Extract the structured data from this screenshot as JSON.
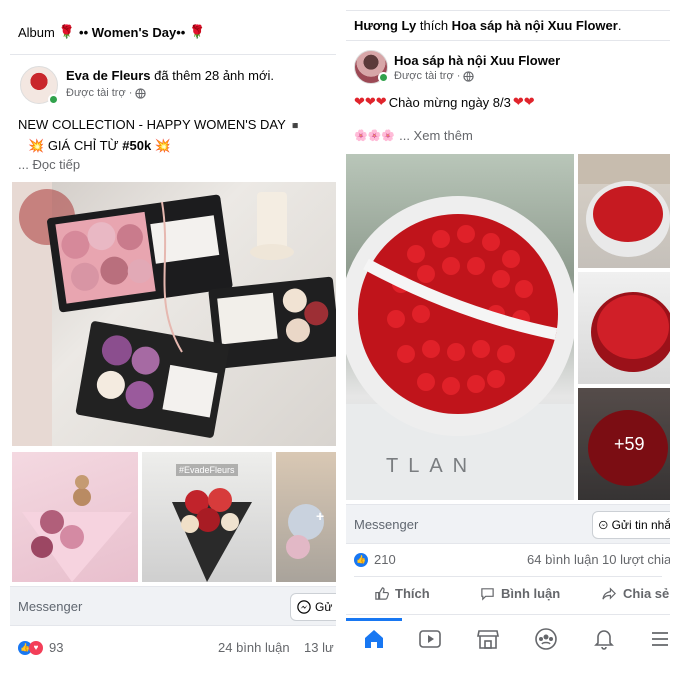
{
  "left": {
    "album_header": {
      "prefix": "Album",
      "emoji_left": "🌹",
      "title": "•• Women's Day••",
      "emoji_right": "🌹"
    },
    "page_name": "Eva de Fleurs",
    "action_text": "đã thêm 28 ảnh mới.",
    "sponsored": "Được tài trợ ·",
    "post_line1": "NEW COLLECTION - HAPPY WOMEN'S DAY",
    "post_line1_icon": "◾",
    "post_line2_prefix": "GIÁ CHỈ TỪ",
    "post_line2_price": "#50k",
    "post_line2_emoji": "💥",
    "read_more": "... Đọc tiếp",
    "thumb_label": "#EvadeFleurs",
    "messenger_label": "Messenger",
    "messenger_button": "Gử",
    "reactions_count": "93",
    "comments_count": "24 bình luận",
    "shares_partial": "13 lư"
  },
  "right": {
    "top_line_user": "Hương Ly",
    "top_line_verb": "thích",
    "top_line_page": "Hoa sáp hà nội Xuu Flower",
    "page_name": "Hoa sáp hà nội Xuu Flower",
    "sponsored": "Được tài trợ ·",
    "post_line1": "Chào mừng ngày 8/3",
    "post_line2_emoji": "🌸🌸🌸",
    "see_more": "... Xem thêm",
    "more_photos": "+59",
    "messenger_label": "Messenger",
    "messenger_button": "Gửi tin nhắ",
    "reactions_count": "210",
    "comments_count": "64 bình luận",
    "shares_count": "10 lượt chia",
    "actions": {
      "like": "Thích",
      "comment": "Bình luận",
      "share": "Chia sẻ"
    },
    "nav_items": [
      "home-icon",
      "watch-icon",
      "marketplace-icon",
      "groups-icon",
      "notifications-icon",
      "menu-icon"
    ]
  },
  "colors": {
    "facebook_blue": "#1877f2",
    "like_blue": "#1877f2",
    "love_red": "#f33e58",
    "rose_red": "#d7141c",
    "text_grey": "#65676b"
  }
}
